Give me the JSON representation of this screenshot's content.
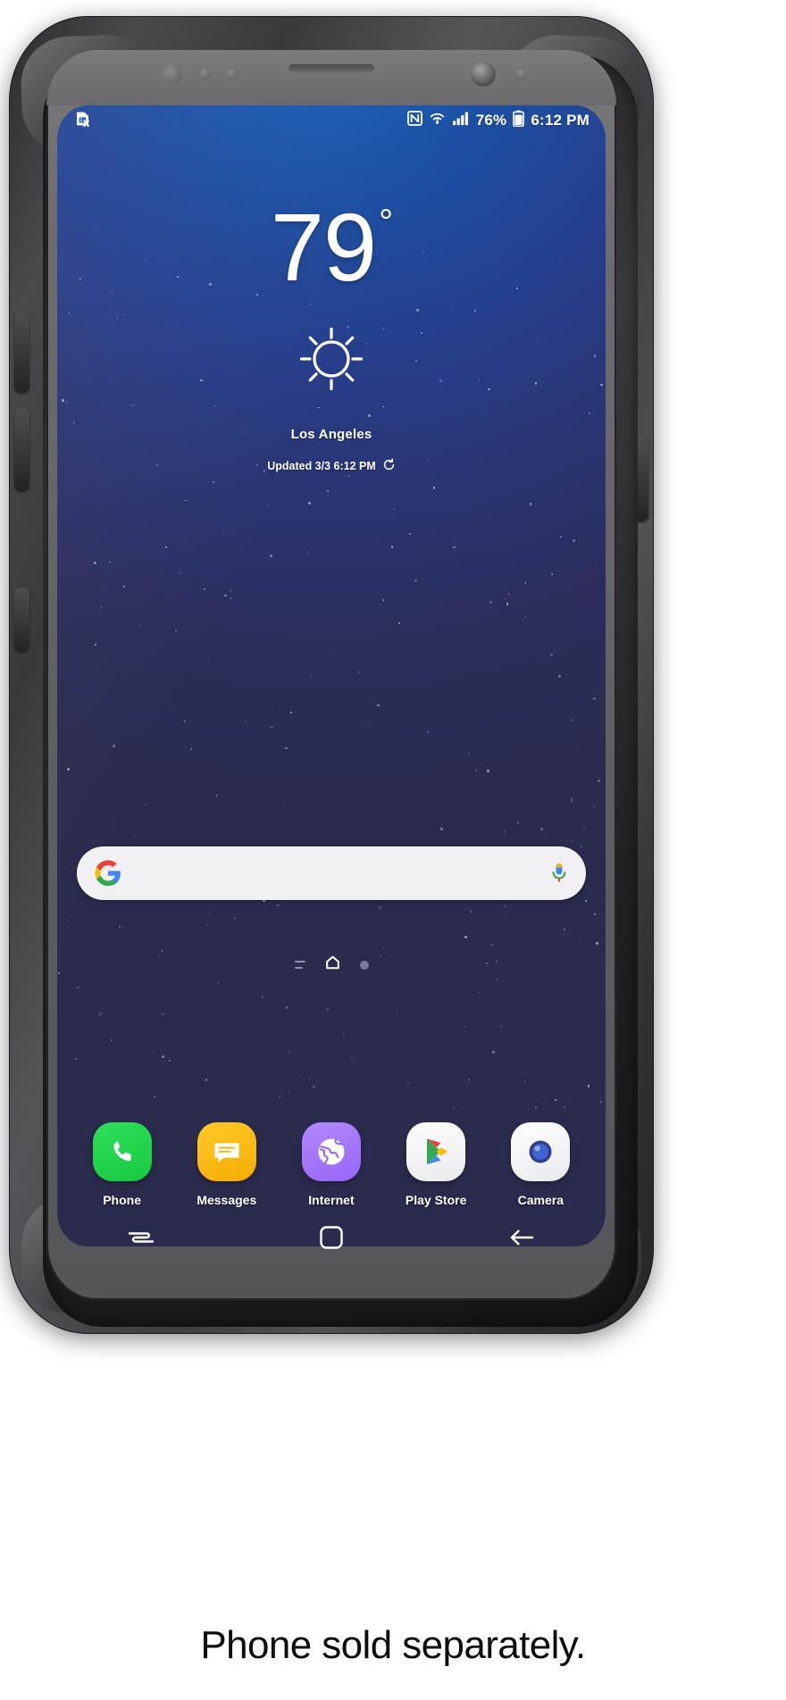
{
  "product_photo": {
    "caption": "Phone sold separately.",
    "device": "smartphone-in-protective-case"
  },
  "status_bar": {
    "left_icons": [
      {
        "name": "no-sim-card-icon",
        "label": "No SIM card"
      }
    ],
    "right_icons": [
      {
        "name": "nfc-icon",
        "label": "NFC"
      },
      {
        "name": "wifi-icon",
        "label": "Wi-Fi"
      },
      {
        "name": "cellular-signal-icon",
        "label": "Signal"
      }
    ],
    "battery_percent": "76%",
    "battery_icon": "battery-icon",
    "time": "6:12 PM"
  },
  "weather_widget": {
    "temperature": "79",
    "degree_symbol": "°",
    "condition_icon": "sunny-icon",
    "city": "Los Angeles",
    "updated": "Updated 3/3 6:12 PM",
    "refresh_icon": "refresh-icon"
  },
  "search_bar": {
    "logo_icon": "google-logo-icon",
    "mic_icon": "microphone-icon",
    "value": "",
    "placeholder": ""
  },
  "page_indicator": {
    "menu_icon": "hamburger-lines-icon",
    "home_icon": "home-icon",
    "dot_icon": "page-dot-icon",
    "pages": 3,
    "active_page": 2
  },
  "dock": {
    "apps": [
      {
        "label": "Phone",
        "icon": "phone-handset-icon",
        "color": "#22d44c"
      },
      {
        "label": "Messages",
        "icon": "message-bubble-icon",
        "color": "#f8b500"
      },
      {
        "label": "Internet",
        "icon": "globe-icon",
        "color": "#a37cff"
      },
      {
        "label": "Play Store",
        "icon": "play-store-icon",
        "color": "#ffffff"
      },
      {
        "label": "Camera",
        "icon": "camera-lens-icon",
        "color": "#ffffff"
      }
    ]
  },
  "nav_bar": {
    "buttons": [
      {
        "name": "recents-button",
        "icon": "recents-icon"
      },
      {
        "name": "home-button",
        "icon": "home-square-icon"
      },
      {
        "name": "back-button",
        "icon": "back-arrow-icon"
      }
    ]
  },
  "colors": {
    "wallpaper_top": "#1565c0",
    "wallpaper_bottom": "#2b2b4e",
    "status_bar_blue": "#1565c0",
    "case_gray": "#3a3a3c",
    "caption_text": "#0d0d0d"
  }
}
